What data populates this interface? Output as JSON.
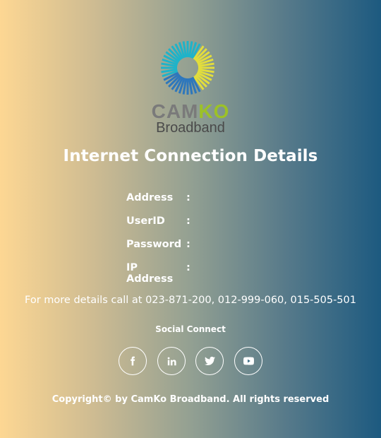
{
  "brand": {
    "logo_text_top_gray": "CAM",
    "logo_text_top_green": "KO",
    "logo_text_bottom": "Broadband",
    "colors": {
      "gray": "#7a7a7a",
      "green": "#9cc128",
      "blue": "#2e77bc",
      "teal": "#1fb3c9",
      "yellow": "#e2dd3c"
    }
  },
  "page": {
    "title": "Internet Connection Details"
  },
  "details": [
    {
      "label": "Address",
      "separator": ":",
      "value": ""
    },
    {
      "label": "UserID",
      "separator": ":",
      "value": ""
    },
    {
      "label": "Password",
      "separator": ":",
      "value": ""
    },
    {
      "label": "IP Address",
      "separator": ":",
      "value": ""
    }
  ],
  "contact": {
    "text": "For more details call at 023-871-200, 012-999-060, 015-505-501"
  },
  "social": {
    "title": "Social Connect",
    "links": [
      {
        "icon": "facebook-icon"
      },
      {
        "icon": "linkedin-icon"
      },
      {
        "icon": "twitter-icon"
      },
      {
        "icon": "youtube-icon"
      }
    ]
  },
  "footer": {
    "copyright": "Copyright© by CamKo Broadband. All rights reserved"
  }
}
